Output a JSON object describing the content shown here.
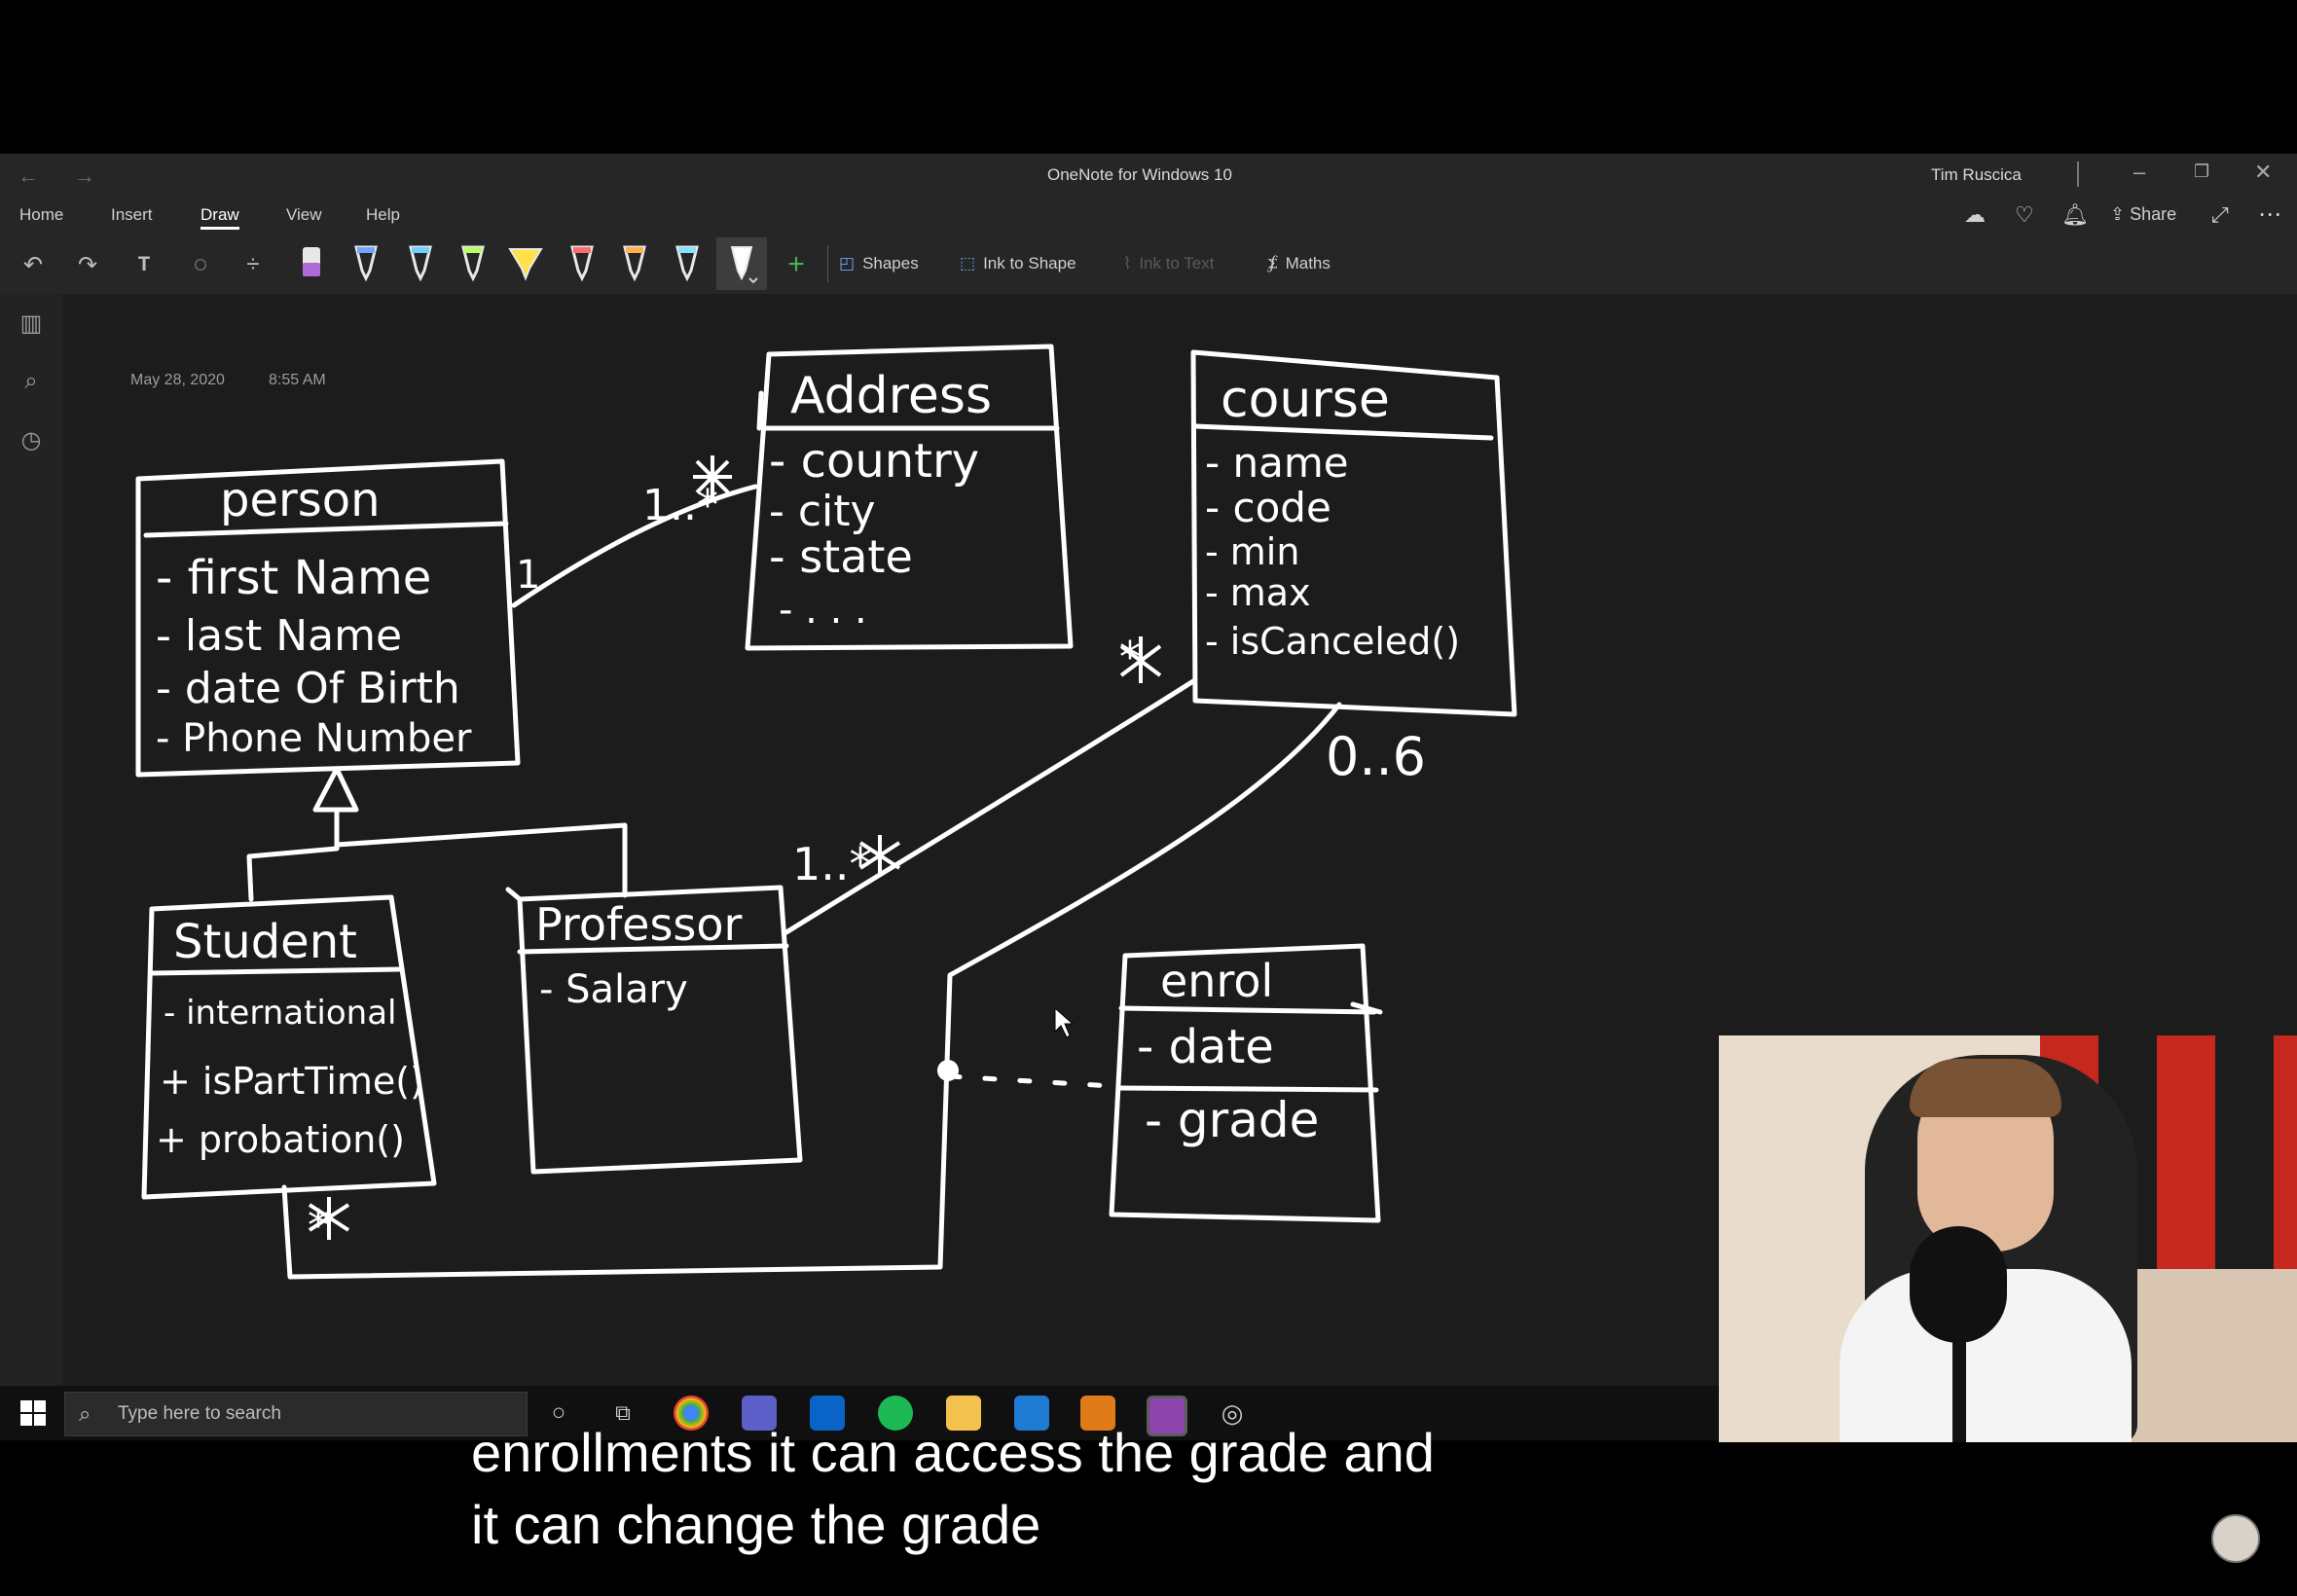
{
  "window": {
    "title": "OneNote for Windows 10",
    "user": "Tim Ruscica",
    "controls": [
      "minimize-icon",
      "restore-icon",
      "close-icon"
    ]
  },
  "ribbon": {
    "tabs": [
      "Home",
      "Insert",
      "Draw",
      "View",
      "Help"
    ],
    "active_tab": "Draw",
    "right_actions": {
      "share_label": "Share"
    }
  },
  "draw_toolbar": {
    "shapes_label": "Shapes",
    "ink_to_shape_label": "Ink to Shape",
    "ink_to_text_label": "Ink to Text",
    "maths_label": "Maths",
    "pen_colors": [
      "#b06ad6",
      "#6fa8ff",
      "#6fd0ff",
      "#b5ff6a",
      "#ffe14a",
      "#ff6a6a",
      "#ffb04a",
      "#8ae0ff",
      "#ffffff"
    ]
  },
  "page": {
    "date": "May 28, 2020",
    "time": "8:55 AM"
  },
  "diagram": {
    "person": {
      "title": "person",
      "attrs": [
        "- first Name",
        "- last Name",
        "- date Of Birth",
        "- Phone Number"
      ]
    },
    "address": {
      "title": "Address",
      "attrs": [
        "- country",
        "- city",
        "- state",
        "- . . ."
      ]
    },
    "course": {
      "title": "course",
      "attrs": [
        "- name",
        "- code",
        "- min",
        "- max",
        "- isCanceled()"
      ]
    },
    "student": {
      "title": "Student",
      "attrs": [
        "- international",
        "+ isPartTime()",
        "+ probation()"
      ]
    },
    "professor": {
      "title": "Professor",
      "attrs": [
        "- Salary"
      ]
    },
    "enrol": {
      "title": "enrol",
      "attrs": [
        "- date",
        "- grade"
      ]
    },
    "multiplicities": {
      "person_address_person": "1",
      "person_address_address": "1..*",
      "course_professor_course": "*",
      "course_professor_professor": "1..*",
      "course_student_course": "0..6",
      "student_course_student": "*"
    }
  },
  "taskbar": {
    "search_placeholder": "Type here to search"
  },
  "caption": {
    "line1": "enrollments it can access the grade and",
    "line2": "it can change the grade"
  }
}
